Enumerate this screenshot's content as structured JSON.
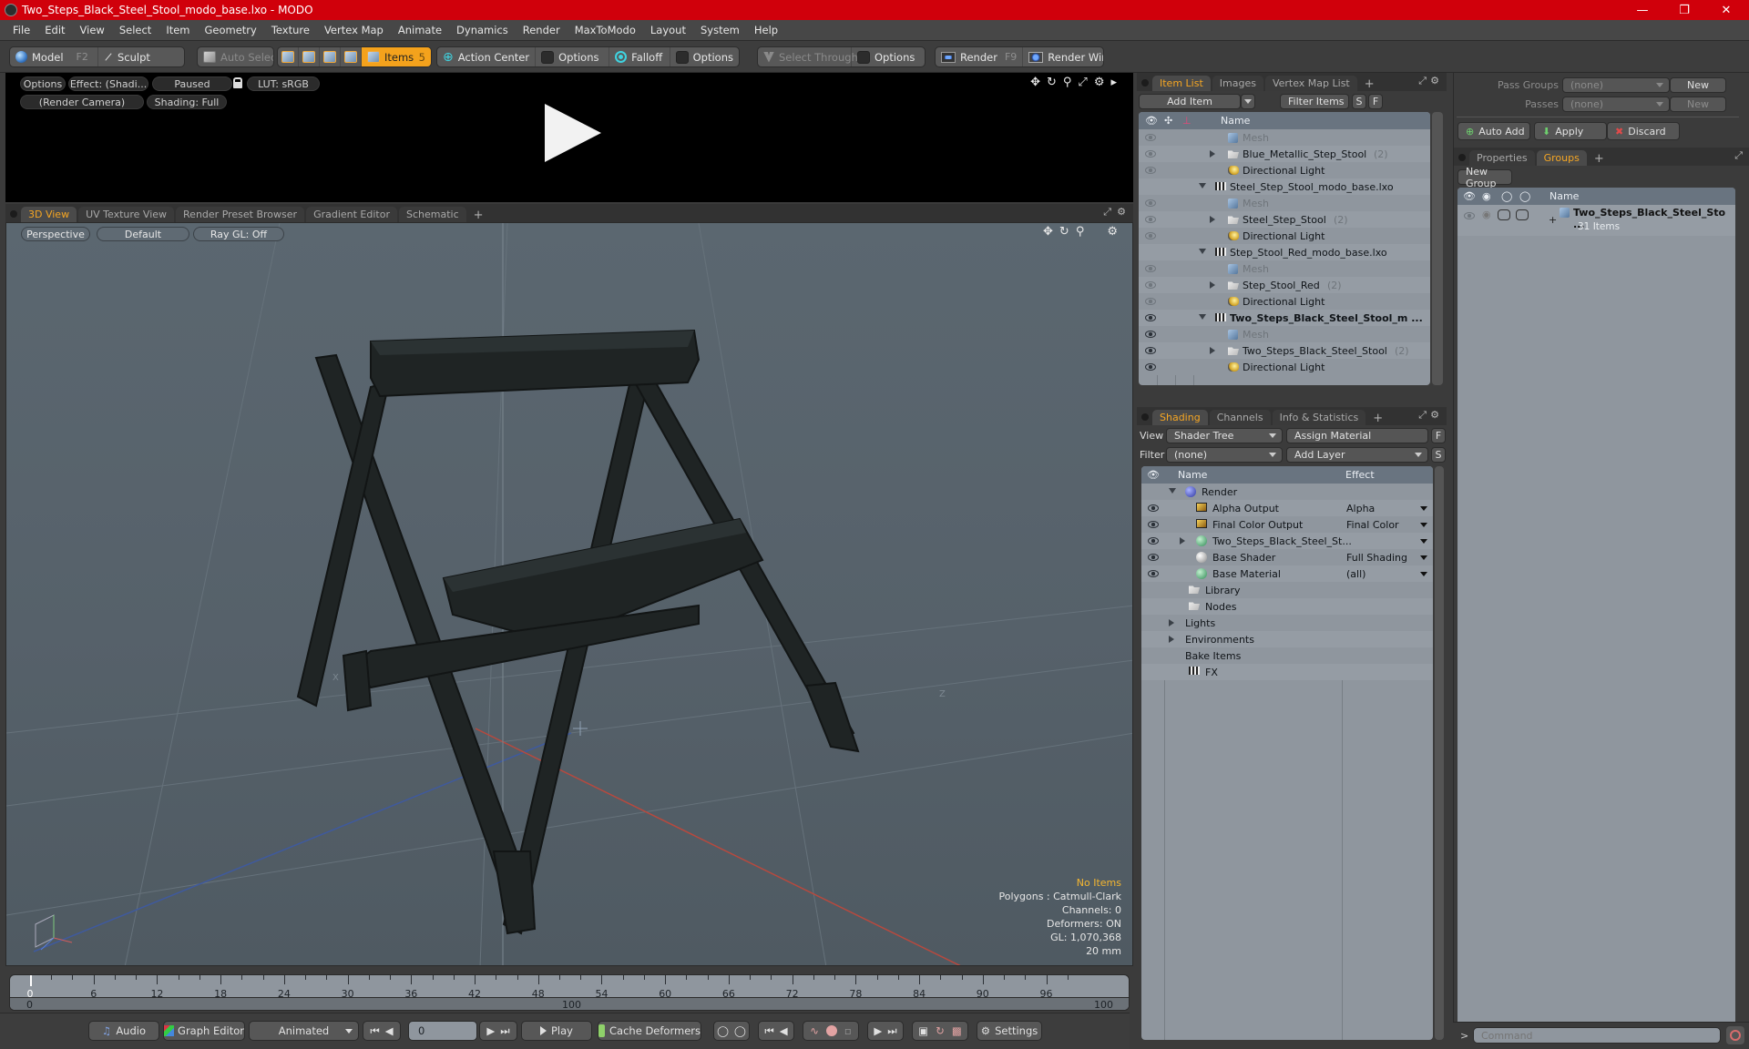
{
  "window": {
    "title": "Two_Steps_Black_Steel_Stool_modo_base.lxo - MODO",
    "controls": [
      "minimize",
      "restore",
      "close"
    ]
  },
  "menu": [
    "File",
    "Edit",
    "View",
    "Select",
    "Item",
    "Geometry",
    "Texture",
    "Vertex Map",
    "Animate",
    "Dynamics",
    "Render",
    "MaxToModo",
    "Layout",
    "System",
    "Help"
  ],
  "toolbar": {
    "model": "Model",
    "model_key": "F2",
    "sculpt": "Sculpt",
    "auto_select": "Auto Select",
    "items": "Items",
    "items_count": "5",
    "action_center": "Action Center",
    "options1": "Options",
    "falloff": "Falloff",
    "options2": "Options",
    "select_through": "Select Through",
    "options3": "Options",
    "render": "Render",
    "render_key": "F9",
    "render_window": "Render Window"
  },
  "render_preview": {
    "options": "Options",
    "effect": "Effect: (Shadi...",
    "status": "Paused",
    "lut": "LUT: sRGB",
    "camera": "(Render Camera)",
    "shading": "Shading: Full"
  },
  "viewport_tabs": [
    "3D View",
    "UV Texture View",
    "Render Preset Browser",
    "Gradient Editor",
    "Schematic"
  ],
  "viewport": {
    "projection": "Perspective",
    "style": "Default",
    "raygl": "Ray GL: Off",
    "info": {
      "selection": "No Items",
      "polygons": "Polygons : Catmull-Clark",
      "channels": "Channels: 0",
      "deformers": "Deformers: ON",
      "gl": "GL: 1,070,368",
      "unit": "20 mm"
    },
    "axis_labels": {
      "x": "X",
      "z": "Z"
    }
  },
  "item_list": {
    "tabs": [
      "Item List",
      "Images",
      "Vertex Map List"
    ],
    "add_item": "Add Item",
    "filter": "Filter Items",
    "s": "S",
    "f": "F",
    "col_name": "Name",
    "rows": [
      {
        "label": "Mesh",
        "type": "mesh",
        "indent": 2,
        "dim": true,
        "eye": "dim"
      },
      {
        "label": "Blue_Metallic_Step_Stool",
        "count": "(2)",
        "type": "folder",
        "indent": 2,
        "expand": "right",
        "eye": "dim"
      },
      {
        "label": "Directional Light",
        "type": "light",
        "indent": 2,
        "eye": "dim"
      },
      {
        "label": "Steel_Step_Stool_modo_base.lxo",
        "type": "scene",
        "indent": 1,
        "expand": "down",
        "eye": "none"
      },
      {
        "label": "Mesh",
        "type": "mesh",
        "indent": 2,
        "dim": true,
        "eye": "dim"
      },
      {
        "label": "Steel_Step_Stool",
        "count": "(2)",
        "type": "folder",
        "indent": 2,
        "expand": "right",
        "eye": "dim"
      },
      {
        "label": "Directional Light",
        "type": "light",
        "indent": 2,
        "eye": "dim"
      },
      {
        "label": "Step_Stool_Red_modo_base.lxo",
        "type": "scene",
        "indent": 1,
        "expand": "down",
        "eye": "none"
      },
      {
        "label": "Mesh",
        "type": "mesh",
        "indent": 2,
        "dim": true,
        "eye": "dim"
      },
      {
        "label": "Step_Stool_Red",
        "count": "(2)",
        "type": "folder",
        "indent": 2,
        "expand": "right",
        "eye": "dim"
      },
      {
        "label": "Directional Light",
        "type": "light",
        "indent": 2,
        "eye": "dim"
      },
      {
        "label": "Two_Steps_Black_Steel_Stool_m ...",
        "type": "scene",
        "indent": 1,
        "expand": "down",
        "bold": true,
        "eye": "on"
      },
      {
        "label": "Mesh",
        "type": "mesh",
        "indent": 2,
        "dim": true,
        "eye": "on"
      },
      {
        "label": "Two_Steps_Black_Steel_Stool",
        "count": "(2)",
        "type": "folder",
        "indent": 2,
        "expand": "right",
        "eye": "on"
      },
      {
        "label": "Directional Light",
        "type": "light",
        "indent": 2,
        "eye": "on"
      }
    ]
  },
  "shading": {
    "tabs": [
      "Shading",
      "Channels",
      "Info & Statistics"
    ],
    "view_label": "View",
    "view_value": "Shader Tree",
    "assign_material": "Assign Material",
    "filter_label": "Filter",
    "filter_value": "(none)",
    "add_layer": "Add Layer",
    "f": "F",
    "s": "S",
    "col_name": "Name",
    "col_effect": "Effect",
    "rows": [
      {
        "label": "Render",
        "effect": "",
        "icon": "render-ball",
        "indent": 0,
        "expand": "down",
        "eye": false
      },
      {
        "label": "Alpha Output",
        "effect": "Alpha",
        "icon": "output",
        "indent": 1,
        "eye": true
      },
      {
        "label": "Final Color Output",
        "effect": "Final Color",
        "icon": "output",
        "indent": 1,
        "eye": true
      },
      {
        "label": "Two_Steps_Black_Steel_St...",
        "effect": "",
        "icon": "material-mask",
        "indent": 1,
        "expand": "right",
        "eye": true
      },
      {
        "label": "Base Shader",
        "effect": "Full Shading",
        "icon": "shader-ball",
        "indent": 1,
        "eye": true
      },
      {
        "label": "Base Material",
        "effect": "(all)",
        "icon": "material-ball",
        "indent": 1,
        "eye": true
      },
      {
        "label": "Library",
        "effect": "",
        "icon": "folder",
        "indent": 1,
        "eye": false
      },
      {
        "label": "Nodes",
        "effect": "",
        "icon": "folder",
        "indent": 1,
        "eye": false
      },
      {
        "label": "Lights",
        "effect": "",
        "icon": "none",
        "indent": 0,
        "expand": "right",
        "eye": false
      },
      {
        "label": "Environments",
        "effect": "",
        "icon": "none",
        "indent": 0,
        "expand": "right",
        "eye": false
      },
      {
        "label": "Bake Items",
        "effect": "",
        "icon": "none",
        "indent": 0,
        "eye": false
      },
      {
        "label": "FX",
        "effect": "",
        "icon": "scene",
        "indent": 1,
        "eye": false
      }
    ]
  },
  "passes": {
    "pass_groups_label": "Pass Groups",
    "pass_groups_value": "(none)",
    "passes_label": "Passes",
    "passes_value": "(none)",
    "new1": "New",
    "new2": "New",
    "auto_add": "Auto Add",
    "apply": "Apply",
    "discard": "Discard"
  },
  "groups": {
    "tabs": [
      "Properties",
      "Groups"
    ],
    "new_group": "New Group",
    "col_name": "Name",
    "item_name": "Two_Steps_Black_Steel_Sto ...",
    "item_count": "31 Items"
  },
  "timeline": {
    "ticks": [
      0,
      6,
      12,
      18,
      24,
      30,
      36,
      42,
      48,
      54,
      60,
      66,
      72,
      78,
      84,
      90,
      96
    ],
    "range_start": "0",
    "range_mid": "100",
    "range_end": "100",
    "current": 0
  },
  "transport": {
    "audio": "Audio",
    "graph_editor": "Graph Editor",
    "mode": "Animated",
    "frame": "0",
    "play": "Play",
    "cache_deformers": "Cache Deformers",
    "settings": "Settings"
  },
  "command": {
    "prompt": ">",
    "placeholder": "Command"
  },
  "colors": {
    "titlebar": "#d0000b",
    "accent": "#f5a623",
    "panel": "#8f969e"
  }
}
